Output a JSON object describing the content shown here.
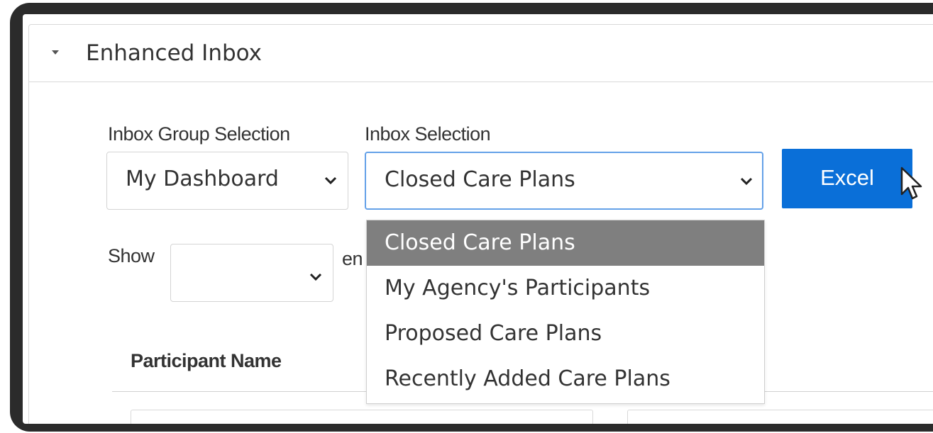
{
  "panel": {
    "title": "Enhanced Inbox",
    "collapse_icon": "caret-down-icon"
  },
  "filters": {
    "inbox_group_label": "Inbox Group Selection",
    "inbox_group_value": "My Dashboard",
    "inbox_selection_label": "Inbox Selection",
    "inbox_selection_value": "Closed Care Plans",
    "excel_label": "Excel"
  },
  "inbox_dropdown": {
    "options": [
      "Closed Care Plans",
      "My Agency's Participants",
      "Proposed Care Plans",
      "Recently Added Care Plans"
    ],
    "selected_index": 0
  },
  "show": {
    "label": "Show",
    "value": "",
    "suffix_partial": "en"
  },
  "table": {
    "headers": [
      "Participant Name"
    ]
  },
  "colors": {
    "accent": "#0a6fd8",
    "focus_border": "#64a1e8",
    "highlight": "#7f7f7f"
  }
}
